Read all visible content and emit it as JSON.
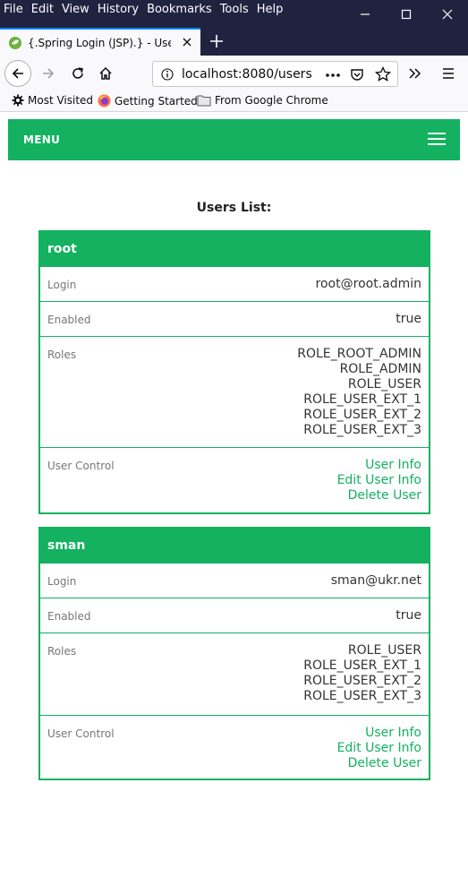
{
  "window": {
    "menu": [
      "File",
      "Edit",
      "View",
      "History",
      "Bookmarks",
      "Tools",
      "Help"
    ]
  },
  "tab": {
    "title": "{.Spring Login (JSP).} - Users List"
  },
  "address": {
    "url": "localhost:8080/users"
  },
  "bookmarks": {
    "items": [
      "Most Visited",
      "Getting Started",
      "From Google Chrome"
    ]
  },
  "page": {
    "menu_label": "MENU",
    "heading": "Users List:",
    "colors": {
      "accent": "#13b160",
      "chrome": "#202340"
    },
    "users": [
      {
        "name": "root",
        "login_label": "Login",
        "login": "root@root.admin",
        "enabled_label": "Enabled",
        "enabled": "true",
        "roles_label": "Roles",
        "roles": [
          "ROLE_ROOT_ADMIN",
          "ROLE_ADMIN",
          "ROLE_USER",
          "ROLE_USER_EXT_1",
          "ROLE_USER_EXT_2",
          "ROLE_USER_EXT_3"
        ],
        "control_label": "User Control",
        "links": [
          "User Info",
          "Edit User Info",
          "Delete User"
        ]
      },
      {
        "name": "sman",
        "login_label": "Login",
        "login": "sman@ukr.net",
        "enabled_label": "Enabled",
        "enabled": "true",
        "roles_label": "Roles",
        "roles": [
          "ROLE_USER",
          "ROLE_USER_EXT_1",
          "ROLE_USER_EXT_2",
          "ROLE_USER_EXT_3"
        ],
        "control_label": "User Control",
        "links": [
          "User Info",
          "Edit User Info",
          "Delete User"
        ]
      }
    ]
  }
}
